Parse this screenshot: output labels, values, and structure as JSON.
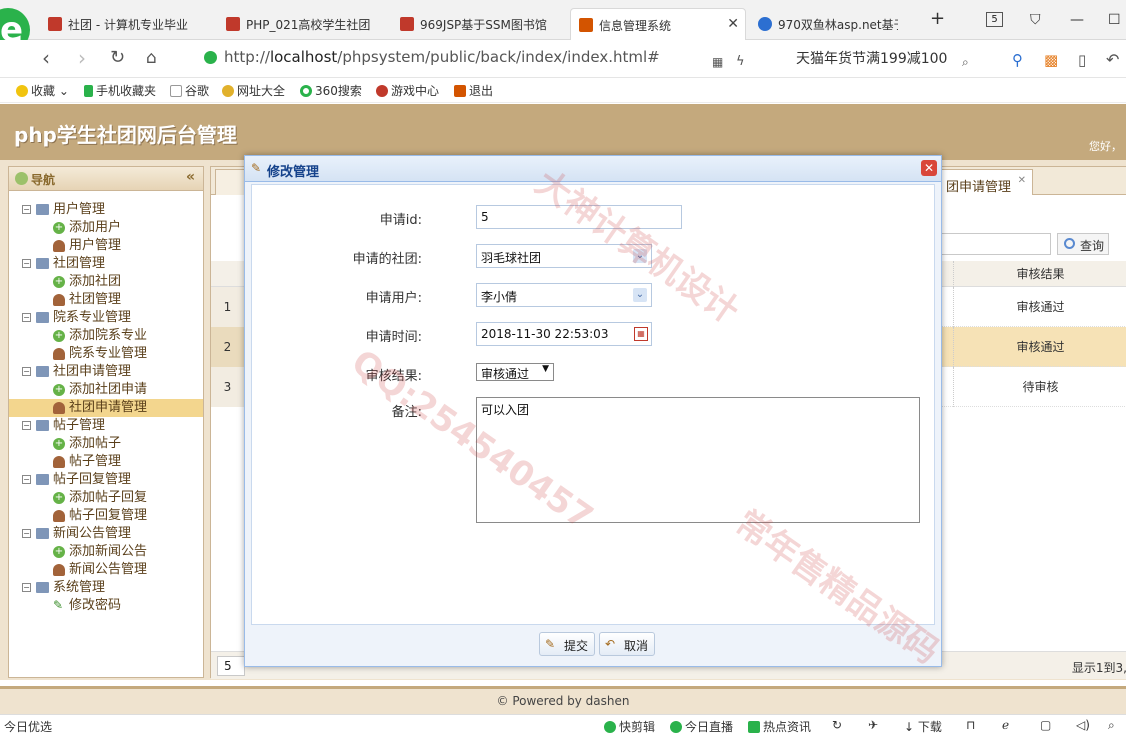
{
  "browser": {
    "tabs": [
      {
        "label": "社团 - 计算机专业毕业"
      },
      {
        "label": "PHP_021高校学生社团"
      },
      {
        "label": "969JSP基于SSM图书馆"
      },
      {
        "label": "信息管理系统"
      },
      {
        "label": "970双鱼林asp.net基于"
      }
    ],
    "tab_count": "5",
    "url_prefix": "http://",
    "url_host": "localhost",
    "url_path": "/phpsystem/public/back/index/index.html#",
    "promo_text": "天猫年货节满199减100",
    "favorites": [
      {
        "label": "收藏",
        "icon": "star-icon"
      },
      {
        "label": "手机收藏夹",
        "icon": "phone-icon"
      },
      {
        "label": "谷歌",
        "icon": "page-icon"
      },
      {
        "label": "网址大全",
        "icon": "globe-icon"
      },
      {
        "label": "360搜索",
        "icon": "search-icon"
      },
      {
        "label": "游戏中心",
        "icon": "game-icon"
      },
      {
        "label": "退出",
        "icon": "exit-icon"
      }
    ]
  },
  "app": {
    "title": "php学生社团网后台管理",
    "greeting": "您好，",
    "footer": "© Powered by dashen"
  },
  "sidebar": {
    "title": "导航",
    "collapse_icon": "«",
    "items": [
      {
        "label": "用户管理",
        "level": 1
      },
      {
        "label": "添加用户",
        "level": 2,
        "icon": "add"
      },
      {
        "label": "用户管理",
        "level": 2,
        "icon": "user"
      },
      {
        "label": "社团管理",
        "level": 1
      },
      {
        "label": "添加社团",
        "level": 2,
        "icon": "add"
      },
      {
        "label": "社团管理",
        "level": 2,
        "icon": "user"
      },
      {
        "label": "院系专业管理",
        "level": 1
      },
      {
        "label": "添加院系专业",
        "level": 2,
        "icon": "add"
      },
      {
        "label": "院系专业管理",
        "level": 2,
        "icon": "user"
      },
      {
        "label": "社团申请管理",
        "level": 1
      },
      {
        "label": "添加社团申请",
        "level": 2,
        "icon": "add"
      },
      {
        "label": "社团申请管理",
        "level": 2,
        "icon": "user",
        "selected": true
      },
      {
        "label": "帖子管理",
        "level": 1
      },
      {
        "label": "添加帖子",
        "level": 2,
        "icon": "add"
      },
      {
        "label": "帖子管理",
        "level": 2,
        "icon": "user"
      },
      {
        "label": "帖子回复管理",
        "level": 1
      },
      {
        "label": "添加帖子回复",
        "level": 2,
        "icon": "add"
      },
      {
        "label": "帖子回复管理",
        "level": 2,
        "icon": "user"
      },
      {
        "label": "新闻公告管理",
        "level": 1
      },
      {
        "label": "添加新闻公告",
        "level": 2,
        "icon": "add"
      },
      {
        "label": "新闻公告管理",
        "level": 2,
        "icon": "user"
      },
      {
        "label": "系统管理",
        "level": 1
      },
      {
        "label": "修改密码",
        "level": 2,
        "icon": "pencil"
      }
    ]
  },
  "content": {
    "active_tab": "团申请管理",
    "search_button": "查询",
    "column_header": "审核结果",
    "rows": [
      {
        "num": "1",
        "result": "审核通过"
      },
      {
        "num": "2",
        "result": "审核通过"
      },
      {
        "num": "3",
        "result": "待审核"
      }
    ],
    "page_size": "5",
    "pager_info": "显示1到3,"
  },
  "dialog": {
    "title": "修改管理",
    "fields": {
      "id_label": "申请id:",
      "id_value": "5",
      "club_label": "申请的社团:",
      "club_value": "羽毛球社团",
      "user_label": "申请用户:",
      "user_value": "李小倩",
      "time_label": "申请时间:",
      "time_value": "2018-11-30 22:53:03",
      "result_label": "审核结果:",
      "result_value": "审核通过",
      "note_label": "备注:",
      "note_value": "可以入团"
    },
    "submit_label": "提交",
    "cancel_label": "取消"
  },
  "statusbar": {
    "left_text": "今日优选",
    "items": [
      "快剪辑",
      "今日直播",
      "热点资讯",
      "下载"
    ]
  },
  "watermark": {
    "texts": [
      "QQ:254540457",
      "大神计算机设计",
      "常年售精品源码"
    ]
  },
  "colors": {
    "header_bg": "#c4a97d",
    "dialog_title": "#15428b",
    "selected_row": "#f6e2b6",
    "browser_green": "#2ab24b"
  }
}
